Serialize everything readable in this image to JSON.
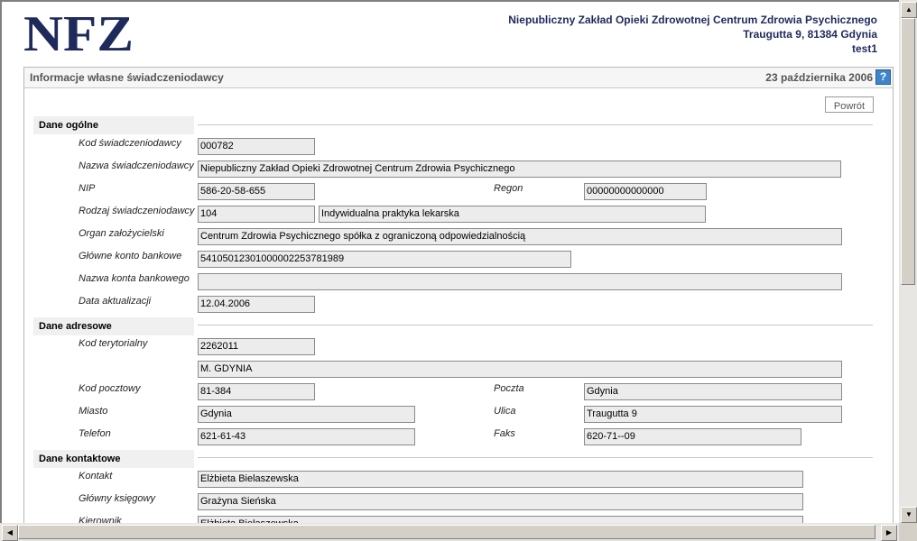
{
  "header": {
    "logo_text": "NFZ",
    "org_name": "Niepubliczny Zakład Opieki Zdrowotnej Centrum Zdrowia Psychicznego",
    "address": "Traugutta 9, 81384 Gdynia",
    "user": "test1"
  },
  "panel": {
    "title": "Informacje własne świadczeniodawcy",
    "date": "23 października 2006",
    "help": "?",
    "back_label": "Powrót"
  },
  "sections": {
    "general": "Dane ogólne",
    "address": "Dane adresowe",
    "contact": "Dane kontaktowe"
  },
  "general": {
    "kod_label": "Kod świadczeniodawcy",
    "kod": "000782",
    "nazwa_label": "Nazwa świadczeniodawcy",
    "nazwa": "Niepubliczny Zakład Opieki Zdrowotnej Centrum Zdrowia Psychicznego",
    "nip_label": "NIP",
    "nip": "586-20-58-655",
    "regon_label": "Regon",
    "regon": "00000000000000",
    "rodzaj_label": "Rodzaj świadczeniodawcy",
    "rodzaj_kod": "104",
    "rodzaj_nazwa": "Indywidualna praktyka lekarska",
    "organ_label": "Organ założycielski",
    "organ": "Centrum Zdrowia Psychicznego spółka z ograniczoną odpowiedzialnością",
    "konto_label": "Główne konto bankowe",
    "konto": "54105012301000002253781989",
    "nazwa_konta_label": "Nazwa konta bankowego",
    "nazwa_konta": "",
    "data_label": "Data aktualizacji",
    "data": "12.04.2006"
  },
  "address": {
    "kod_ter_label": "Kod terytorialny",
    "kod_ter": "2262011",
    "gmina": "M. GDYNIA",
    "kod_poczt_label": "Kod pocztowy",
    "kod_poczt": "81-384",
    "poczta_label": "Poczta",
    "poczta": "Gdynia",
    "miasto_label": "Miasto",
    "miasto": "Gdynia",
    "ulica_label": "Ulica",
    "ulica": "Traugutta 9",
    "telefon_label": "Telefon",
    "telefon": "621-61-43",
    "faks_label": "Faks",
    "faks": "620-71--09"
  },
  "contact": {
    "kontakt_label": "Kontakt",
    "kontakt": "Elżbieta Bielaszewska",
    "ksiegowy_label": "Główny księgowy",
    "ksiegowy": "Grażyna Sieńska",
    "kierownik_label": "Kierownik",
    "kierownik": "Elżbieta Bielaszewska"
  },
  "colors": {
    "brand": "#1f2a5c",
    "field_bg": "#ececec",
    "help_blue": "#3d84c8"
  }
}
